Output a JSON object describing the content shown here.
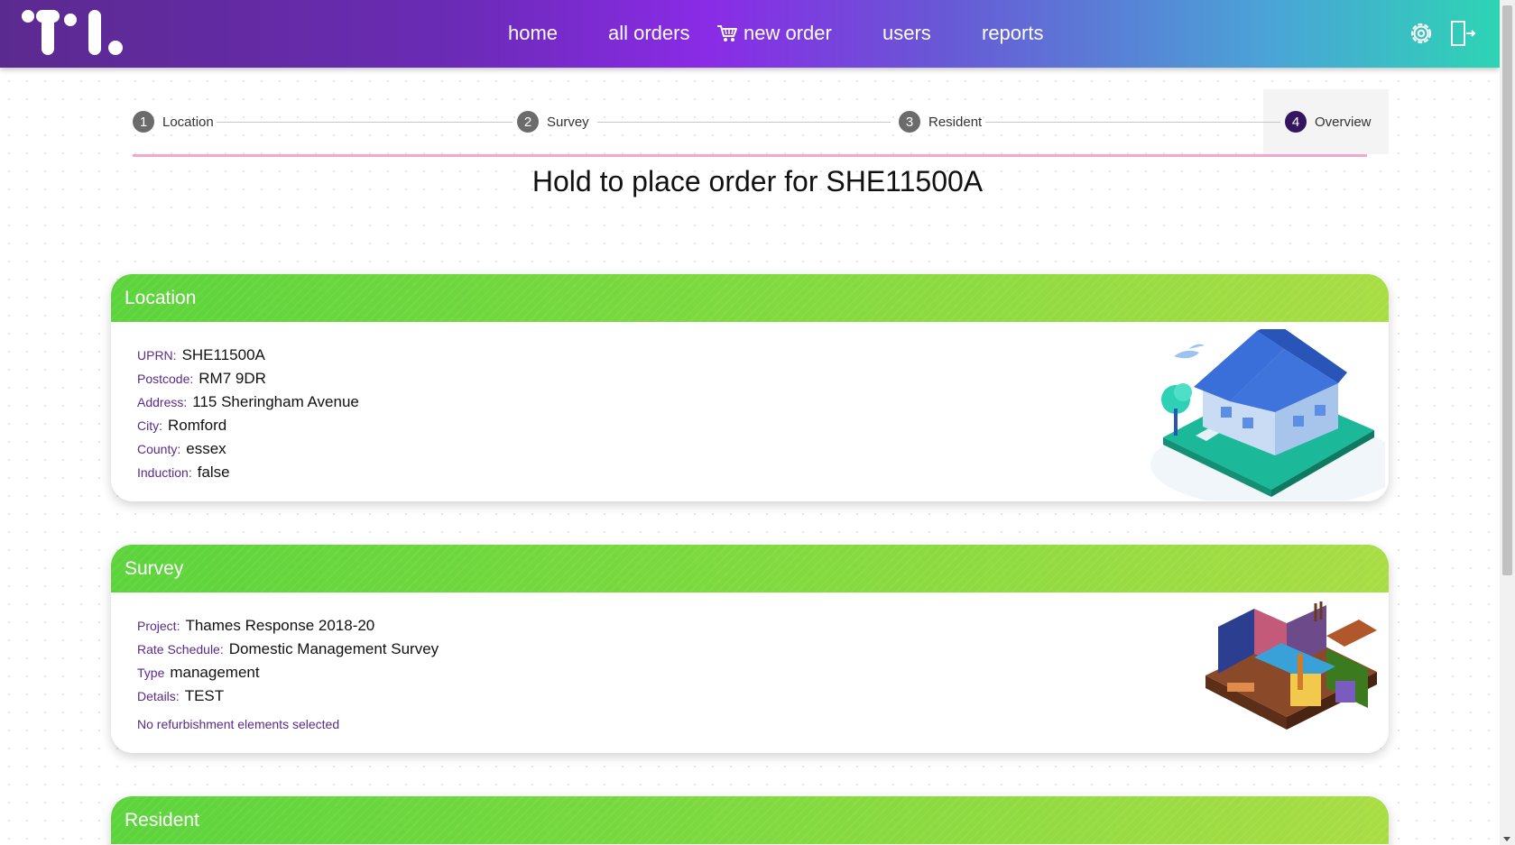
{
  "colors": {
    "nav_gradient": [
      "#5b2a8f",
      "#8a2be6",
      "#2dd4b4"
    ],
    "card_header_green": "#6bd540",
    "label_purple": "#5a2a8a",
    "active_step": "#33165f",
    "step_underline": "#f3a6cf"
  },
  "nav": {
    "items": [
      {
        "label": "home"
      },
      {
        "label": "all orders"
      },
      {
        "label": "new order",
        "icon": "cart-icon"
      },
      {
        "label": "users"
      },
      {
        "label": "reports"
      }
    ],
    "right_icons": [
      "settings-icon",
      "logout-icon"
    ]
  },
  "stepper": {
    "steps": [
      {
        "number": "1",
        "label": "Location"
      },
      {
        "number": "2",
        "label": "Survey"
      },
      {
        "number": "3",
        "label": "Resident"
      },
      {
        "number": "4",
        "label": "Overview",
        "active": true
      }
    ]
  },
  "page_title": "Hold to place order for SHE11500A",
  "location": {
    "header": "Location",
    "fields": [
      {
        "key": "UPRN:",
        "value": "SHE11500A"
      },
      {
        "key": "Postcode:",
        "value": "RM7 9DR"
      },
      {
        "key": "Address:",
        "value": "115 Sheringham Avenue"
      },
      {
        "key": "City:",
        "value": "Romford"
      },
      {
        "key": "County:",
        "value": "essex"
      },
      {
        "key": "Induction:",
        "value": "false"
      }
    ],
    "illustration": "house-illustration"
  },
  "survey": {
    "header": "Survey",
    "fields": [
      {
        "key": "Project:",
        "value": "Thames Response 2018-20"
      },
      {
        "key": "Rate Schedule:",
        "value": "Domestic Management Survey"
      },
      {
        "key": "Type",
        "value": "management"
      },
      {
        "key": "Details:",
        "value": "TEST"
      }
    ],
    "note": "No refurbishment elements selected",
    "illustration": "house-cutaway-illustration"
  },
  "resident": {
    "header": "Resident"
  }
}
